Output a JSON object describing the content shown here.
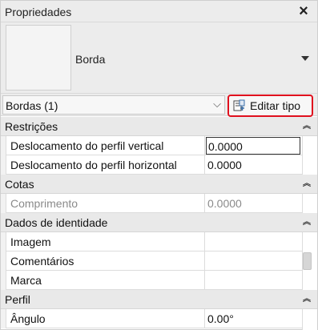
{
  "window": {
    "title": "Propriedades",
    "close_icon": "×"
  },
  "type_selector": {
    "type_name": "Borda",
    "dropdown_icon": "triangle-down"
  },
  "filter": {
    "label": "Bordas (1)",
    "chevron": "⌵"
  },
  "edit_type_button": {
    "label": "Editar tipo",
    "highlight_color": "#e0101e"
  },
  "groups": [
    {
      "label": "Restrições",
      "collapse_glyph": "⌃⌃",
      "rows": [
        {
          "name": "Deslocamento do perfil vertical",
          "value": "0.0000",
          "active": true
        },
        {
          "name": "Deslocamento do perfil horizontal",
          "value": "0.0000"
        }
      ]
    },
    {
      "label": "Cotas",
      "collapse_glyph": "⌃⌃",
      "rows": [
        {
          "name": "Comprimento",
          "value": "0.0000",
          "disabled": true
        }
      ]
    },
    {
      "label": "Dados de identidade",
      "collapse_glyph": "⌃⌃",
      "rows": [
        {
          "name": "Imagem",
          "value": ""
        },
        {
          "name": "Comentários",
          "value": ""
        },
        {
          "name": "Marca",
          "value": ""
        }
      ]
    },
    {
      "label": "Perfil",
      "collapse_glyph": "⌃⌃",
      "rows": [
        {
          "name": "Ângulo",
          "value": "0.00°"
        }
      ]
    }
  ]
}
